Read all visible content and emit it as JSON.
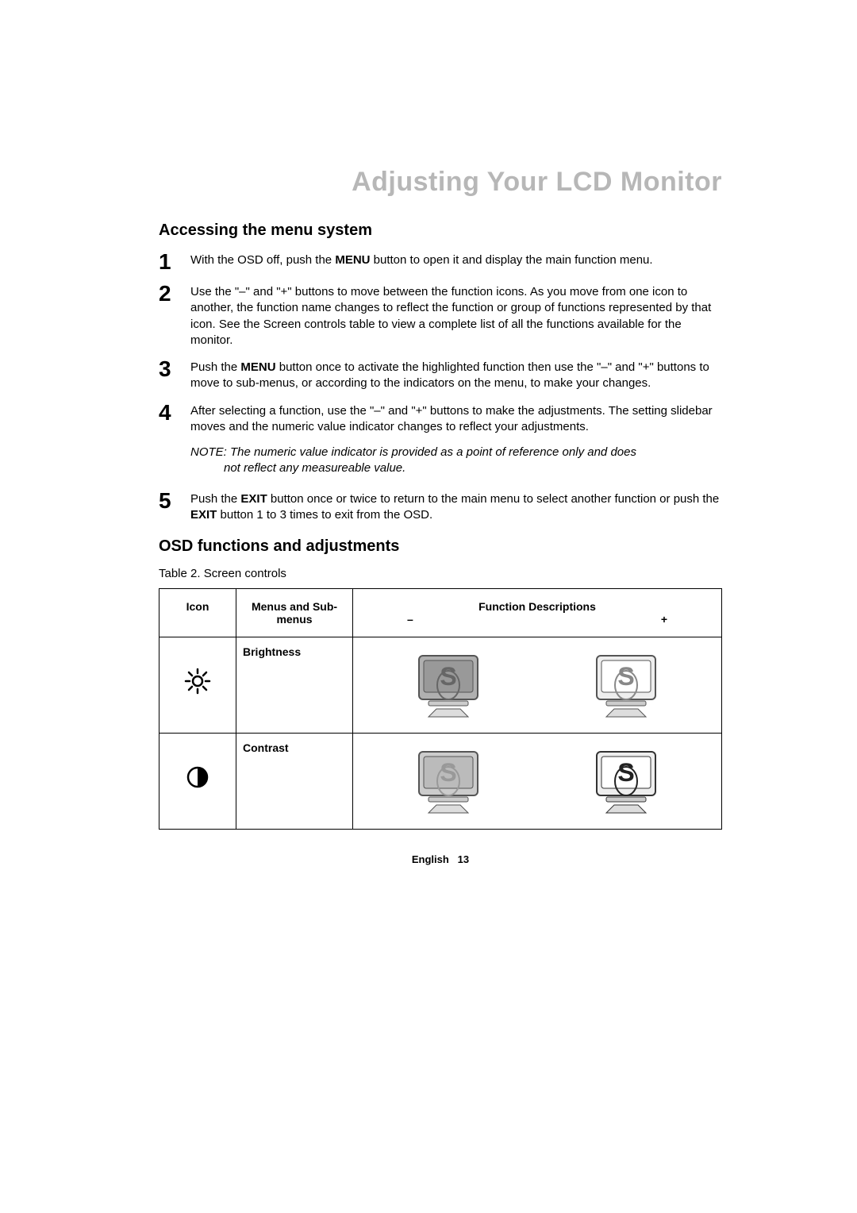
{
  "title": "Adjusting Your LCD Monitor",
  "section1_heading": "Accessing the menu system",
  "steps": {
    "s1_num": "1",
    "s1_pre": "With the OSD off, push the ",
    "s1_bold": "MENU",
    "s1_post": " button to open it and display the main function menu.",
    "s2_num": "2",
    "s2": "Use the \"–\" and \"+\" buttons to move between the function icons. As you move from one icon to another, the function name changes to reflect the function or group of functions represented by that icon. See the Screen controls table to view a complete list of all the functions available for the monitor.",
    "s3_num": "3",
    "s3_pre": "Push the ",
    "s3_bold": "MENU",
    "s3_post": " button once to activate the highlighted function then use the \"–\" and \"+\" buttons to move to sub-menus, or according to the indicators on the menu, to make your changes.",
    "s4_num": "4",
    "s4": "After selecting a function, use the \"–\" and \"+\" buttons to make the adjustments. The setting slidebar moves and the numeric value indicator changes to reflect your adjustments.",
    "note_line1": "NOTE: The numeric value indicator is provided as a point of reference only and does",
    "note_line2": "not reflect any measureable value.",
    "s5_num": "5",
    "s5_pre": "Push the ",
    "s5_b1": "EXIT",
    "s5_mid": " button once or twice to return to the main menu to select another function or push the ",
    "s5_b2": "EXIT",
    "s5_post": " button 1 to 3 times to exit from the OSD."
  },
  "section2_heading": "OSD functions and adjustments",
  "table_caption": "Table 2.  Screen controls",
  "table": {
    "hdr_icon": "Icon",
    "hdr_menus": "Menus and Sub-menus",
    "hdr_func": "Function Descriptions",
    "minus": "–",
    "plus": "+",
    "row1_menu": "Brightness",
    "row2_menu": "Contrast"
  },
  "footer_lang": "English",
  "footer_page": "13"
}
